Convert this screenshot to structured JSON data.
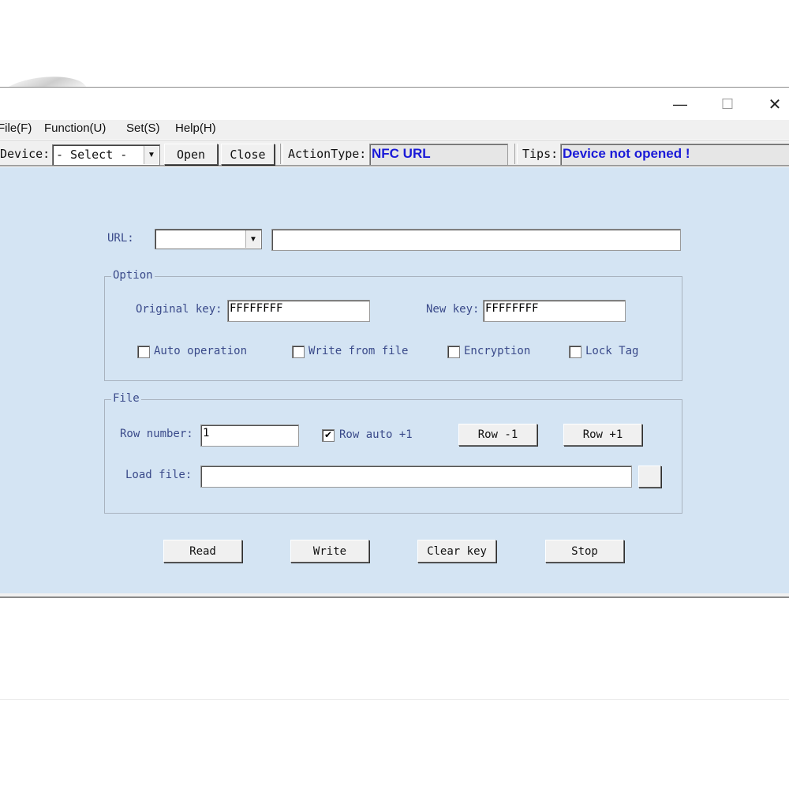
{
  "window": {
    "controls": {
      "minimize": "—",
      "maximize": "☐",
      "close": "✕"
    }
  },
  "menu": {
    "items": [
      "File(F)",
      "Function(U)",
      "Set(S)",
      "Help(H)"
    ]
  },
  "toolbar": {
    "device_label": "Device:",
    "device_value": "- Select -",
    "open_label": "Open",
    "close_label": "Close",
    "actiontype_label": "ActionType:",
    "actiontype_value": "NFC URL",
    "tips_label": "Tips:",
    "tips_value": "Device not opened !",
    "accent_color": "#1a1ad8"
  },
  "form": {
    "url_label": "URL:",
    "url_prefix_value": "",
    "url_value": "",
    "option": {
      "title": "Option",
      "original_key_label": "Original key:",
      "original_key_value": "FFFFFFFF",
      "new_key_label": "New key:",
      "new_key_value": "FFFFFFFF",
      "checkboxes": [
        {
          "label": "Auto operation",
          "checked": false
        },
        {
          "label": "Write from file",
          "checked": false
        },
        {
          "label": "Encryption",
          "checked": false
        },
        {
          "label": "Lock Tag",
          "checked": false
        }
      ]
    },
    "file": {
      "title": "File",
      "row_number_label": "Row number:",
      "row_number_value": "1",
      "row_auto_label": "Row auto +1",
      "row_auto_checked": true,
      "row_minus_label": "Row -1",
      "row_plus_label": "Row +1",
      "load_file_label": "Load file:",
      "load_file_value": ""
    },
    "actions": {
      "read": "Read",
      "write": "Write",
      "clear_key": "Clear key",
      "stop": "Stop"
    }
  },
  "colors": {
    "client_background": "#d4e4f3",
    "label_color": "#3a4a8a"
  }
}
